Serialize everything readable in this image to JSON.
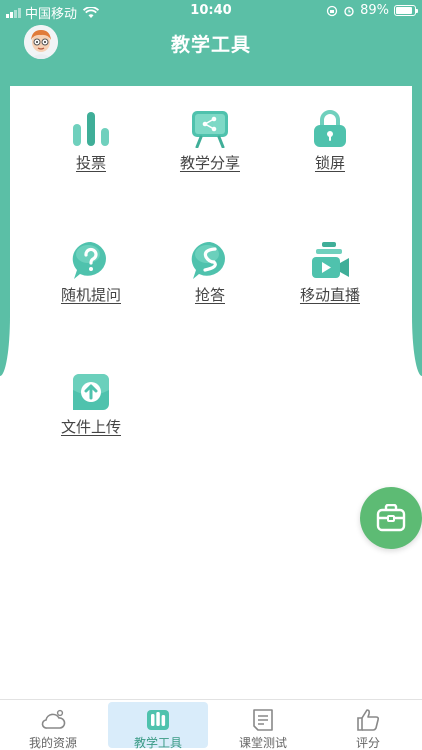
{
  "status_bar": {
    "carrier": "中国移动",
    "time": "10:40",
    "battery": "89%"
  },
  "header": {
    "title": "教学工具"
  },
  "tools": [
    {
      "label": "投票",
      "icon": "vote-chart-icon"
    },
    {
      "label": "教学分享",
      "icon": "share-board-icon"
    },
    {
      "label": "锁屏",
      "icon": "lock-icon"
    },
    {
      "label": "随机提问",
      "icon": "question-bubble-icon"
    },
    {
      "label": "抢答",
      "icon": "quick-answer-icon"
    },
    {
      "label": "移动直播",
      "icon": "live-camera-icon"
    },
    {
      "label": "文件上传",
      "icon": "upload-icon"
    }
  ],
  "fab": {
    "icon": "toolbox-icon"
  },
  "tabbar": [
    {
      "label": "我的资源",
      "icon": "cloud-icon"
    },
    {
      "label": "教学工具",
      "icon": "tools-icon",
      "active": true
    },
    {
      "label": "课堂测试",
      "icon": "test-paper-icon"
    },
    {
      "label": "评分",
      "icon": "thumbs-up-icon"
    }
  ],
  "colors": {
    "header": "#5bbfa6",
    "icon_teal": "#4fc2ad",
    "fab": "#5dbb74",
    "active_tab_bg": "#d9ecfa"
  }
}
